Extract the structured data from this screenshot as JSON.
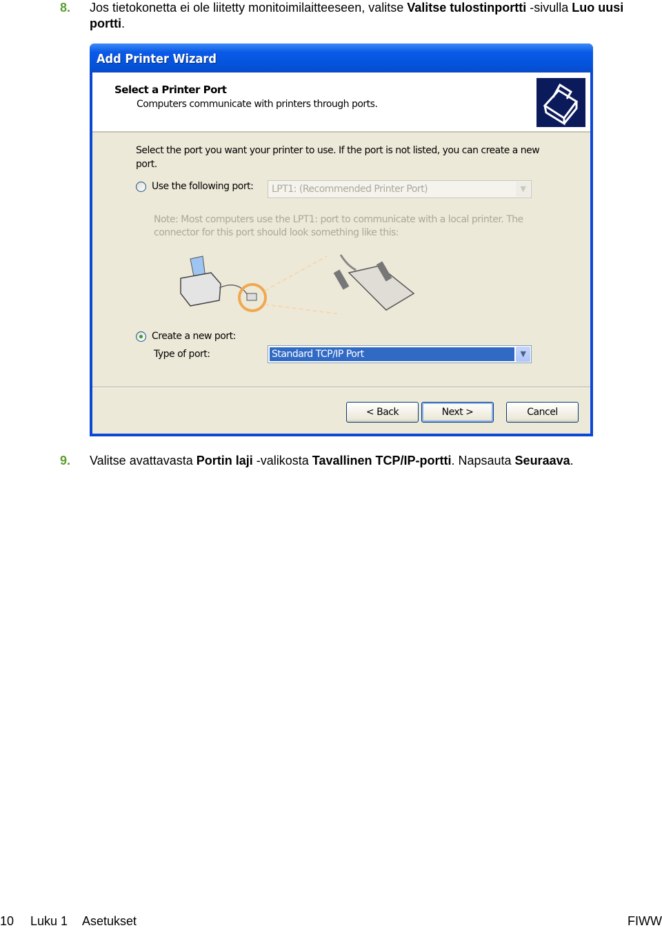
{
  "steps": [
    {
      "number": "8.",
      "segments": [
        {
          "t": "Jos tietokonetta ei ole liitetty monitoimilaitteeseen, valitse ",
          "b": false
        },
        {
          "t": "Valitse tulostinportti",
          "b": true
        },
        {
          "t": " -sivulla ",
          "b": false
        },
        {
          "t": "Luo uusi portti",
          "b": true
        },
        {
          "t": ".",
          "b": false
        }
      ]
    },
    {
      "number": "9.",
      "segments": [
        {
          "t": "Valitse avattavasta ",
          "b": false
        },
        {
          "t": "Portin laji",
          "b": true
        },
        {
          "t": " -valikosta ",
          "b": false
        },
        {
          "t": "Tavallinen TCP/IP-portti",
          "b": true
        },
        {
          "t": ". Napsauta ",
          "b": false
        },
        {
          "t": "Seuraava",
          "b": true
        },
        {
          "t": ".",
          "b": false
        }
      ]
    }
  ],
  "dialog": {
    "title": "Add Printer Wizard",
    "header_title": "Select a Printer Port",
    "header_subtitle": "Computers communicate with printers through ports.",
    "header_icon": "printer-icon",
    "intro": "Select the port you want your printer to use.  If the port is not listed, you can create a new port.",
    "use_port_label": "Use the following port:",
    "use_port_selected": false,
    "use_port_value": "LPT1: (Recommended Printer Port)",
    "note": "Note: Most computers use the LPT1: port to communicate with a local printer. The connector for this port should look something like this:",
    "create_port_label": "Create a new port:",
    "create_port_selected": true,
    "type_label": "Type of port:",
    "type_value": "Standard TCP/IP Port",
    "back": "< Back",
    "next": "Next >",
    "cancel": "Cancel"
  },
  "footer": {
    "page": "10",
    "chapter": "Luku 1",
    "section": "Asetukset",
    "lang": "FIWW"
  },
  "colors": {
    "step_number": "#5c9e2e",
    "titlebar": "#0a5ae8",
    "selection": "#316ac5"
  }
}
